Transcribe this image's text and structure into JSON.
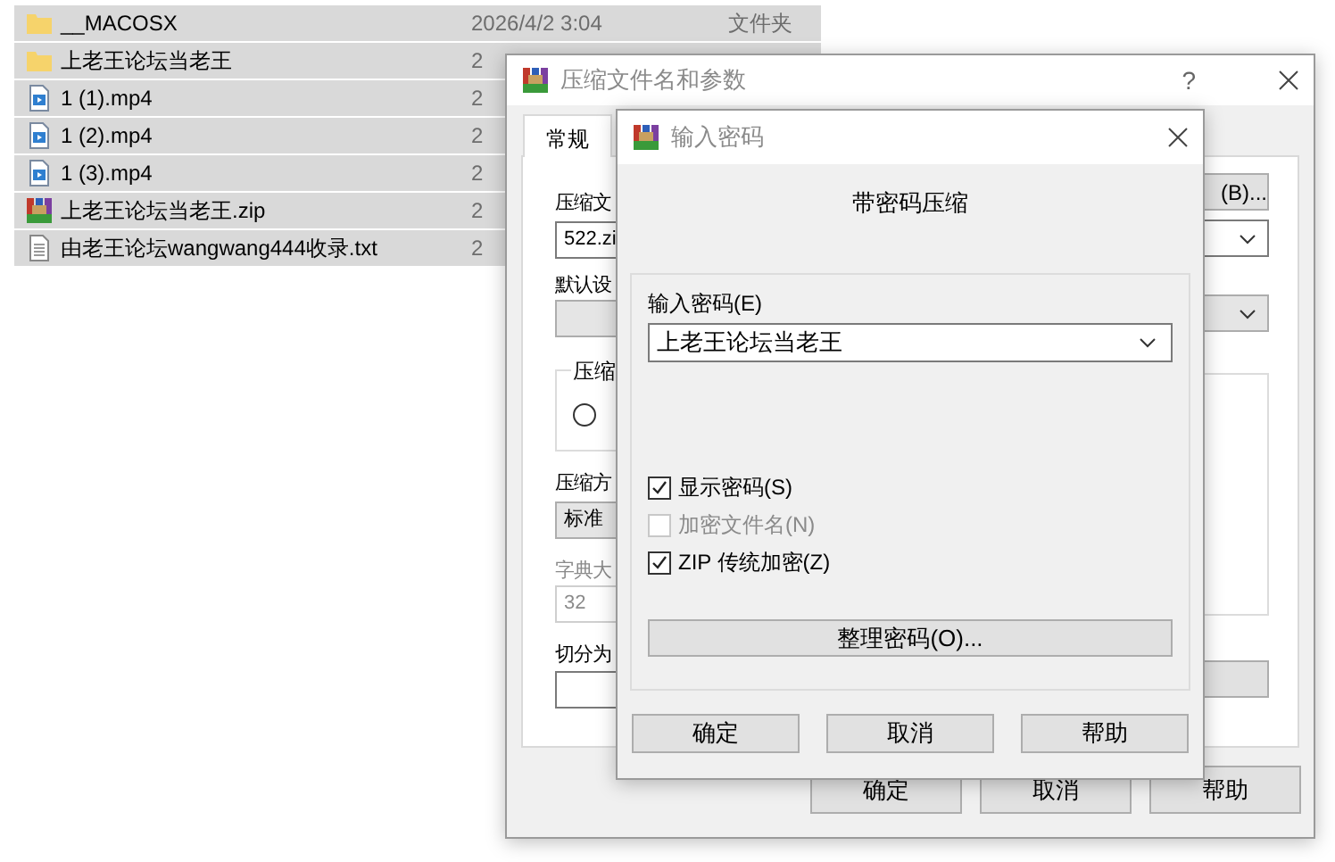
{
  "file_list": {
    "rows": [
      {
        "kind": "folder",
        "name": "__MACOSX",
        "modified": "2026/4/2 3:04",
        "type": "文件夹",
        "selected": true
      },
      {
        "kind": "folder",
        "name": "上老王论坛当老王",
        "modified": "2",
        "selected": true
      },
      {
        "kind": "video",
        "name": "1 (1).mp4",
        "modified": "2",
        "selected": true
      },
      {
        "kind": "video",
        "name": "1 (2).mp4",
        "modified": "2",
        "selected": true
      },
      {
        "kind": "video",
        "name": "1 (3).mp4",
        "modified": "2",
        "selected": true
      },
      {
        "kind": "archive",
        "name": "上老王论坛当老王.zip",
        "modified": "2",
        "selected": true
      },
      {
        "kind": "text",
        "name": "由老王论坛wangwang444收录.txt",
        "modified": "2",
        "selected": true
      }
    ]
  },
  "archive_dialog": {
    "title": "压缩文件名和参数",
    "help": "?",
    "tabs": [
      {
        "label": "常规",
        "selected": true
      }
    ],
    "left": {
      "name_label": "压缩文",
      "name_value": "522.zi",
      "profile_label": "默认设",
      "group_label": "压缩",
      "radio_selected": false,
      "method_label": "压缩方",
      "method_value": "标准",
      "dict_label": "字典大",
      "dict_value": "32",
      "split_label": "切分为"
    },
    "browse_button": "(B)...",
    "buttons": [
      "确定",
      "取消",
      "帮助"
    ]
  },
  "password_dialog": {
    "title": "输入密码",
    "heading": "带密码压缩",
    "password_label": "输入密码(E)",
    "password_value": "上老王论坛当老王",
    "options": [
      {
        "label": "显示密码(S)",
        "checked": true,
        "disabled": false
      },
      {
        "label": "加密文件名(N)",
        "checked": false,
        "disabled": true
      },
      {
        "label": "ZIP 传统加密(Z)",
        "checked": true,
        "disabled": false
      }
    ],
    "manage_button": "整理密码(O)...",
    "buttons": [
      "确定",
      "取消",
      "帮助"
    ]
  }
}
